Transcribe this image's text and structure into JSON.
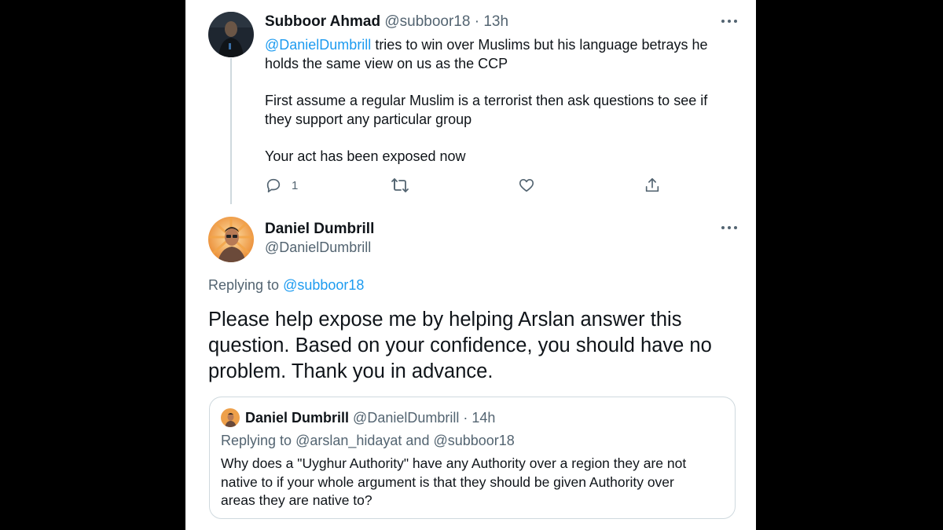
{
  "tweet1": {
    "author_name": "Subboor Ahmad",
    "author_handle": "@subboor18",
    "separator": "·",
    "time": "13h",
    "mention": "@DanielDumbrill",
    "body_line1_rest": " tries to win over Muslims but his language betrays he holds the same view on us as the CCP",
    "body_para2": "First assume a regular Muslim is a terrorist then ask questions to see if they support any particular group",
    "body_para3": "Your act has been exposed now",
    "reply_count": "1",
    "icons": [
      "more-icon",
      "reply-icon",
      "retweet-icon",
      "like-icon",
      "share-icon"
    ]
  },
  "tweet2": {
    "author_name": "Daniel Dumbrill",
    "author_handle": "@DanielDumbrill",
    "replying_prefix": "Replying to ",
    "replying_handle": "@subboor18",
    "text_lines": [
      "Please help expose me by helping Arslan answer this",
      "question.  Based on your confidence, you should have no",
      "problem.  Thank you in advance."
    ]
  },
  "quote": {
    "author_name": "Daniel Dumbrill",
    "author_handle": "@DanielDumbrill",
    "separator": "·",
    "time": "14h",
    "replying_prefix": "Replying to ",
    "replying_handle1": "@arslan_hidayat",
    "replying_and": " and ",
    "replying_handle2": "@subboor18",
    "text_lines": [
      "Why does a \"Uyghur Authority\" have any Authority over a region they are not",
      "native to if your whole argument is that they should be given Authority over",
      "areas they are native to?"
    ]
  },
  "colors": {
    "background": "#000000",
    "card": "#ffffff",
    "text": "#0f1419",
    "muted": "#536471",
    "link": "#1d9bf0",
    "border": "#cfd9de"
  }
}
